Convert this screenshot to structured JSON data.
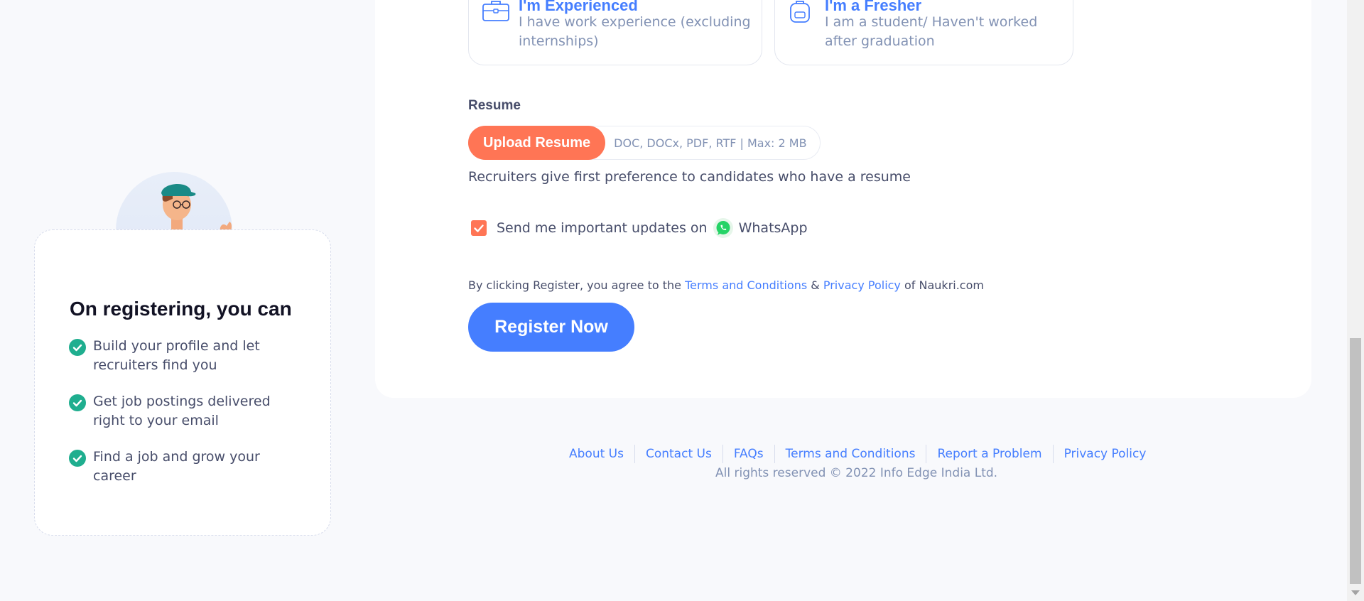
{
  "work_status": {
    "experienced": {
      "title": "I'm Experienced",
      "description": "I have work experience (excluding internships)",
      "icon": "briefcase-icon"
    },
    "fresher": {
      "title": "I'm a Fresher",
      "description": "I am a student/ Haven't worked after graduation",
      "icon": "backpack-icon"
    }
  },
  "resume": {
    "label": "Resume",
    "upload_label": "Upload Resume",
    "formats_hint": "DOC, DOCx, PDF, RTF | Max: 2 MB",
    "note": "Recruiters give first preference to candidates who have a resume"
  },
  "whatsapp": {
    "checked": true,
    "label_prefix": "Send me important updates on",
    "label_brand": "WhatsApp"
  },
  "consent": {
    "prefix": "By clicking Register, you agree to the",
    "terms_link": "Terms and Conditions",
    "amp": "&",
    "privacy_link": "Privacy Policy",
    "suffix": "of Naukri.com"
  },
  "register_label": "Register Now",
  "side": {
    "title": "On registering, you can",
    "benefits": [
      "Build your profile and let recruiters find you",
      "Get job postings delivered right to your email",
      "Find a job and grow your career"
    ]
  },
  "footer": {
    "links": [
      "About Us",
      "Contact Us",
      "FAQs",
      "Terms and Conditions",
      "Report a Problem",
      "Privacy Policy"
    ],
    "copyright": "All rights reserved © 2022 Info Edge India Ltd."
  },
  "colors": {
    "accent_blue": "#457eff",
    "accent_orange": "#ff7555",
    "check_green": "#1fae8f",
    "whatsapp_green": "#25d366"
  }
}
